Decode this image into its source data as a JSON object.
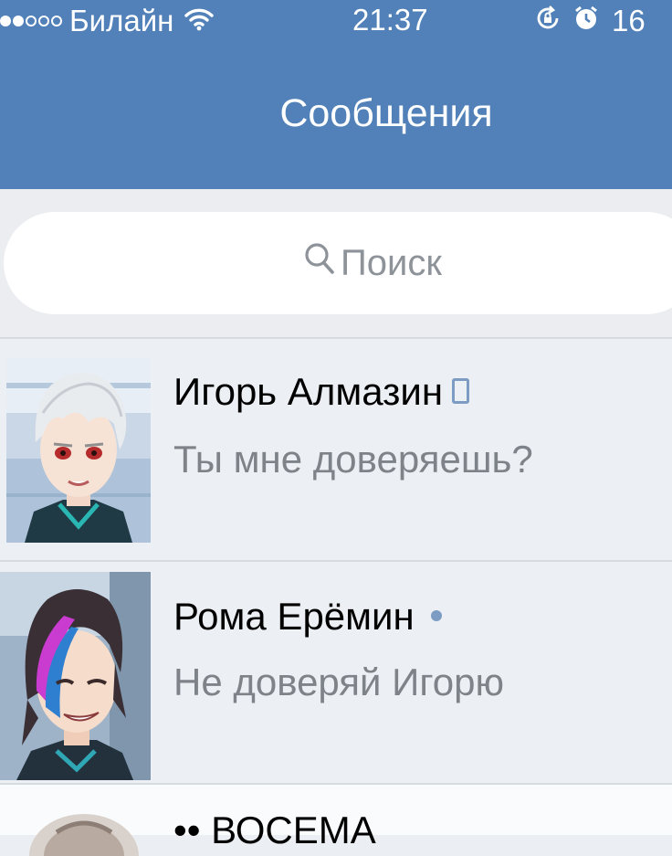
{
  "status_bar": {
    "carrier": "Билайн",
    "time": "21:37",
    "battery_text": "16",
    "signal_strength": "2 of 5",
    "icons": [
      "wifi-icon",
      "orientation-lock-icon",
      "alarm-icon"
    ]
  },
  "header": {
    "title": "Сообщения"
  },
  "search": {
    "placeholder": "Поиск"
  },
  "conversations": [
    {
      "name": "Игорь Алмазин",
      "message": "Ты мне доверяешь?",
      "status_icon": "mobile-online-icon"
    },
    {
      "name": "Рома Ерёмин",
      "message": "Не доверяй Игорю",
      "status_icon": "online-dot-icon"
    },
    {
      "name": "ВОСЕМА",
      "prefix": "••"
    }
  ],
  "colors": {
    "header_bg": "#5181b8",
    "list_bg": "#eceff4",
    "secondary_text": "#7e8389",
    "online_indicator": "#7d9cc3"
  }
}
